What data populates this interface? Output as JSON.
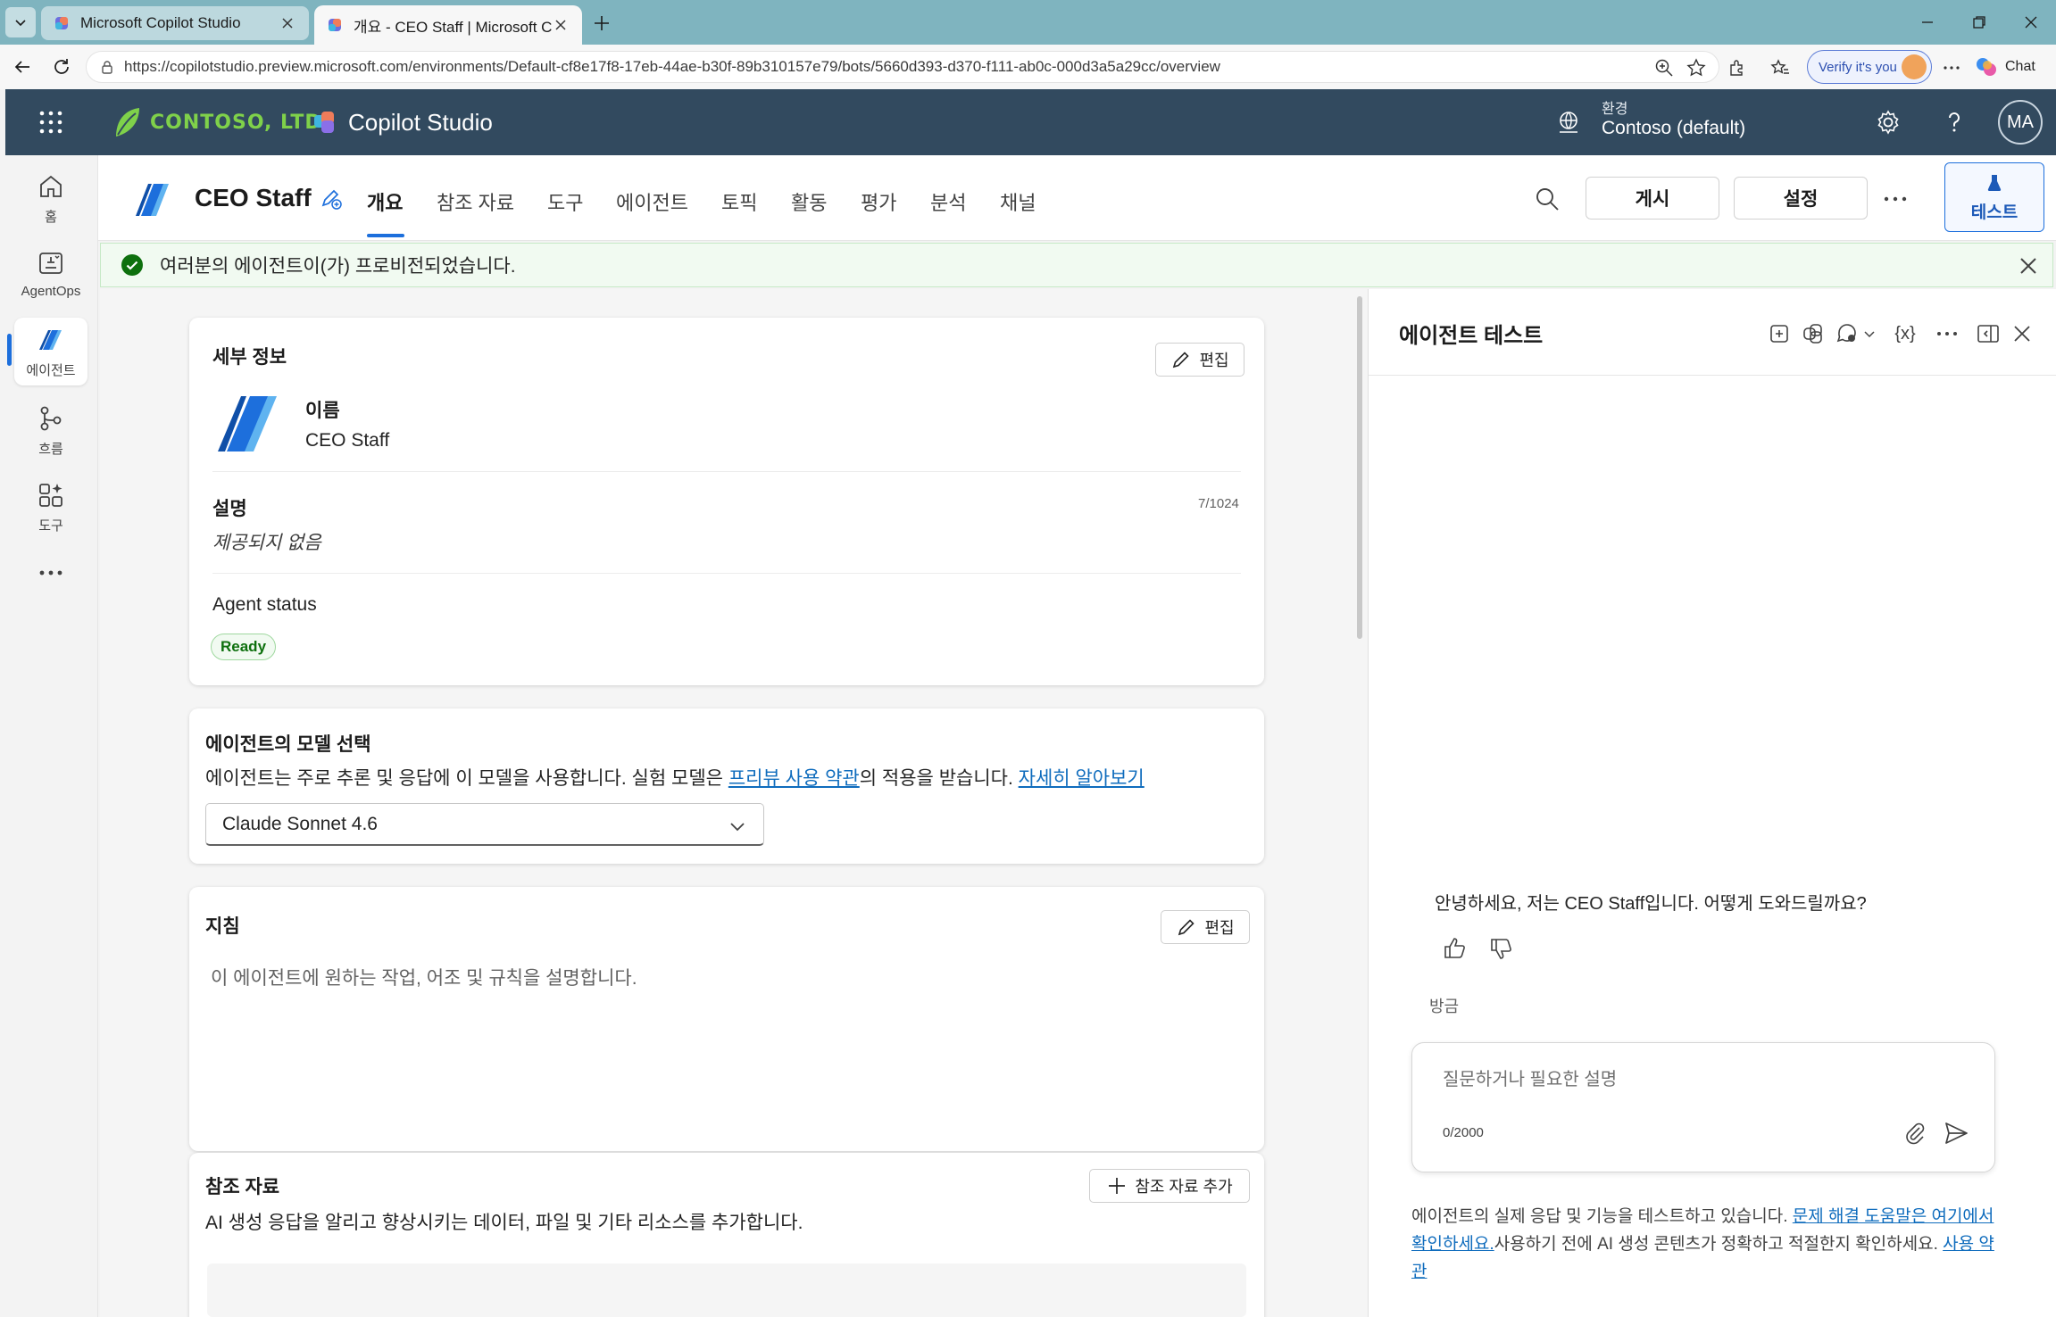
{
  "browser": {
    "tabs": [
      {
        "title": "Microsoft Copilot Studio",
        "active": false
      },
      {
        "title": "개요 - CEO Staff | Microsoft Copilot Studio",
        "active": true
      }
    ],
    "url": "https://copilotstudio.preview.microsoft.com/environments/Default-cf8e17f8-17eb-44ae-b30f-89b310157e79/bots/5660d393-d370-f111-ab0c-000d3a5a29cc/overview",
    "verify_label": "Verify it's you",
    "chat_label": "Chat"
  },
  "header": {
    "org_name": "CONTOSO, LTD.",
    "product_name": "Copilot Studio",
    "env_label": "환경",
    "env_value": "Contoso (default)",
    "user_initials": "MA"
  },
  "rail": {
    "items": [
      {
        "label": "홈",
        "icon": "home-icon"
      },
      {
        "label": "AgentOps",
        "icon": "agentops-icon"
      },
      {
        "label": "에이전트",
        "icon": "agent-icon",
        "selected": true
      },
      {
        "label": "흐름",
        "icon": "flow-icon"
      },
      {
        "label": "도구",
        "icon": "tools-icon"
      }
    ]
  },
  "agent": {
    "name": "CEO Staff",
    "tabs": [
      "개요",
      "참조 자료",
      "도구",
      "에이전트",
      "토픽",
      "활동",
      "평가",
      "분석",
      "채널"
    ],
    "publish_label": "게시",
    "settings_label": "설정",
    "test_label": "테스트"
  },
  "banner": {
    "message": "여러분의 에이전트이(가) 프로비전되었습니다."
  },
  "details": {
    "title": "세부 정보",
    "edit_label": "편집",
    "name_label": "이름",
    "name_value": "CEO Staff",
    "desc_label": "설명",
    "desc_counter": "7/1024",
    "desc_value": "제공되지 없음",
    "status_label": "Agent status",
    "status_value": "Ready"
  },
  "model": {
    "title": "에이전트의 모델 선택",
    "desc_prefix": "에이전트는 주로 추론 및 응답에 이 모델을 사용합니다. 실험 모델은 ",
    "desc_link1": "프리뷰 사용 약관",
    "desc_middle": "의 적용을 받습니다. ",
    "desc_link2": "자세히 알아보기",
    "selected": "Claude Sonnet 4.6"
  },
  "instructions": {
    "title": "지침",
    "edit_label": "편집",
    "placeholder": "이 에이전트에 원하는 작업, 어조 및 규칙을 설명합니다."
  },
  "knowledge": {
    "title": "참조 자료",
    "add_label": "참조 자료 추가",
    "desc": "AI 생성 응답을 알리고 향상시키는 데이터, 파일 및 기타 리소스를 추가합니다."
  },
  "test_panel": {
    "title": "에이전트 테스트",
    "variables_label": "{x}",
    "greeting": "안녕하세요, 저는 CEO Staff입니다. 어떻게 도와드릴까요?",
    "timestamp": "방금",
    "input_placeholder": "질문하거나 필요한 설명",
    "char_count": "0/2000",
    "disclaimer_prefix": "에이전트의 실제 응답 및 기능을 테스트하고 있습니다. ",
    "disclaimer_link1": "문제 해결 도움말은 여기에서 확인하세요.",
    "disclaimer_middle": "사용하기 전에 AI 생성 콘텐츠가 정확하고 적절한지 확인하세요. ",
    "disclaimer_link2": "사용 약관"
  },
  "colors": {
    "header_bg": "#324a5f",
    "accent": "#1d6fdc",
    "success": "#0e700e",
    "link": "#0f6cbd"
  }
}
